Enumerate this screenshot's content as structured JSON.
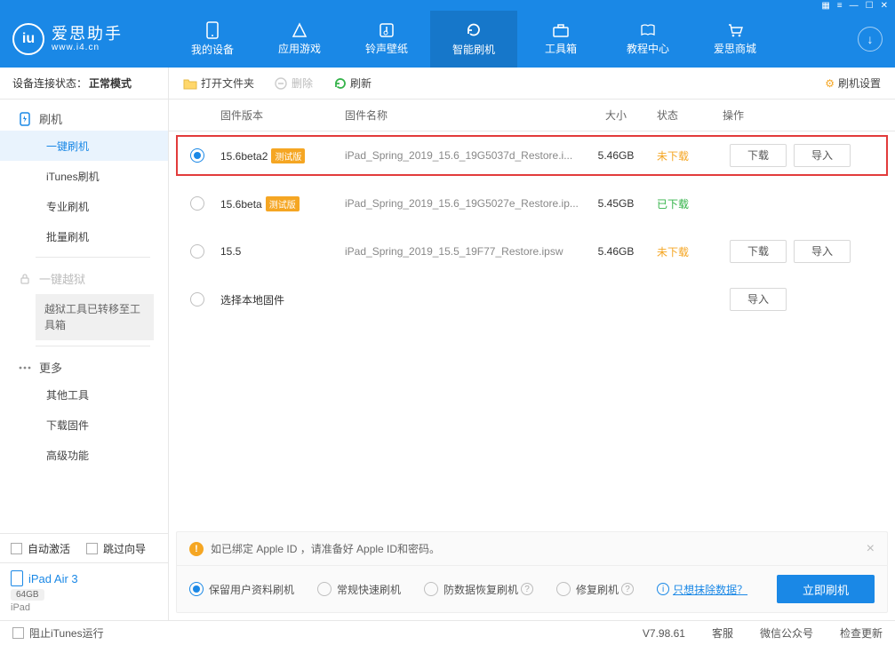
{
  "app": {
    "name": "爱思助手",
    "url": "www.i4.cn",
    "version": "V7.98.61"
  },
  "nav": {
    "items": [
      {
        "label": "我的设备"
      },
      {
        "label": "应用游戏"
      },
      {
        "label": "铃声壁纸"
      },
      {
        "label": "智能刷机"
      },
      {
        "label": "工具箱"
      },
      {
        "label": "教程中心"
      },
      {
        "label": "爱思商城"
      }
    ]
  },
  "conn": {
    "label": "设备连接状态：",
    "value": "正常模式"
  },
  "sidebar": {
    "flash": "刷机",
    "items1": [
      "一键刷机",
      "iTunes刷机",
      "专业刷机",
      "批量刷机"
    ],
    "jailbreak": "一键越狱",
    "jailbreak_note": "越狱工具已转移至工具箱",
    "more": "更多",
    "items2": [
      "其他工具",
      "下载固件",
      "高级功能"
    ]
  },
  "sidebar_bottom": {
    "auto_activate": "自动激活",
    "skip_guide": "跳过向导",
    "device_name": "iPad Air 3",
    "capacity": "64GB",
    "device_type": "iPad"
  },
  "toolbar": {
    "open": "打开文件夹",
    "delete": "删除",
    "refresh": "刷新",
    "settings": "刷机设置"
  },
  "table": {
    "headers": {
      "version": "固件版本",
      "name": "固件名称",
      "size": "大小",
      "status": "状态",
      "action": "操作"
    },
    "rows": [
      {
        "version": "15.6beta2",
        "beta": "测试版",
        "name": "iPad_Spring_2019_15.6_19G5037d_Restore.i...",
        "size": "5.46GB",
        "status": "未下载",
        "status_class": "st-notdl",
        "download": "下载",
        "import": "导入",
        "selected": true,
        "hl": true,
        "showDl": true
      },
      {
        "version": "15.6beta",
        "beta": "测试版",
        "name": "iPad_Spring_2019_15.6_19G5027e_Restore.ip...",
        "size": "5.45GB",
        "status": "已下载",
        "status_class": "st-dl",
        "selected": false,
        "hl": false,
        "showDl": false
      },
      {
        "version": "15.5",
        "beta": "",
        "name": "iPad_Spring_2019_15.5_19F77_Restore.ipsw",
        "size": "5.46GB",
        "status": "未下载",
        "status_class": "st-notdl",
        "download": "下载",
        "import": "导入",
        "selected": false,
        "hl": false,
        "showDl": true
      },
      {
        "version": "选择本地固件",
        "beta": "",
        "name": "",
        "size": "",
        "status": "",
        "import": "导入",
        "selected": false,
        "hl": false,
        "local": true
      }
    ]
  },
  "warn": {
    "text": "如已绑定 Apple ID ，请准备好 Apple ID和密码。"
  },
  "options": {
    "keep": "保留用户资料刷机",
    "normal": "常规快速刷机",
    "anti": "防数据恢复刷机",
    "repair": "修复刷机",
    "erase": "只想抹除数据？",
    "go": "立即刷机"
  },
  "footer": {
    "block_itunes": "阻止iTunes运行",
    "kefu": "客服",
    "wechat": "微信公众号",
    "update": "检查更新"
  },
  "btn": {
    "download": "下载",
    "import": "导入"
  }
}
